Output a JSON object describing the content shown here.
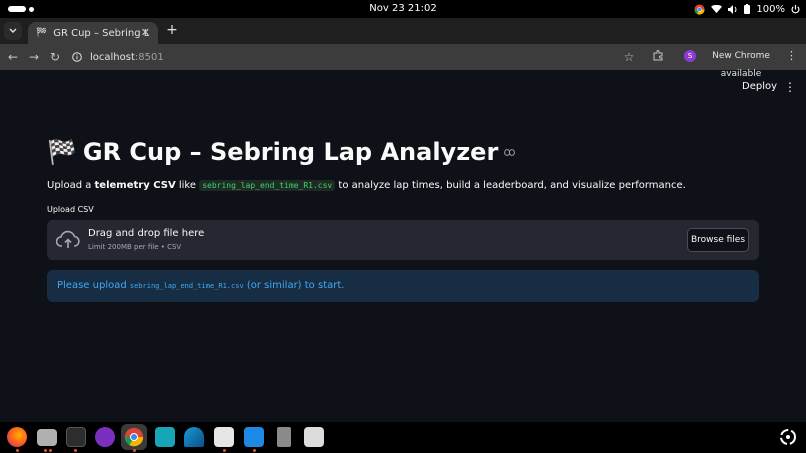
{
  "system": {
    "clock": "Nov 23  21:02",
    "battery": "100%"
  },
  "browser": {
    "tab_title": "GR Cup – Sebring Lap An",
    "url_host": "localhost",
    "url_port": ":8501",
    "profile_initial": "S",
    "new_chrome_label": "New Chrome available"
  },
  "app": {
    "deploy_label": "Deploy",
    "title_icon": "🏁",
    "title": "GR Cup – Sebring Lap Analyzer",
    "lead": {
      "prefix": "Upload a ",
      "bold": "telemetry CSV",
      "mid": " like ",
      "code": "sebring_lap_end_time_R1.csv",
      "suffix": " to analyze lap times, build a leaderboard, and visualize performance."
    },
    "upload_label": "Upload CSV",
    "dropzone_title": "Drag and drop file here",
    "dropzone_subtitle": "Limit 200MB per file • CSV",
    "browse_label": "Browse files",
    "info": {
      "prefix": "Please upload ",
      "code": "sebring_lap_end_time_R1.csv",
      "suffix": " (or similar) to start."
    }
  },
  "colors": {
    "background": "#0e1117",
    "info_bg": "#172d43",
    "info_text": "#3fa9f5",
    "code_text": "#3dd56d"
  }
}
